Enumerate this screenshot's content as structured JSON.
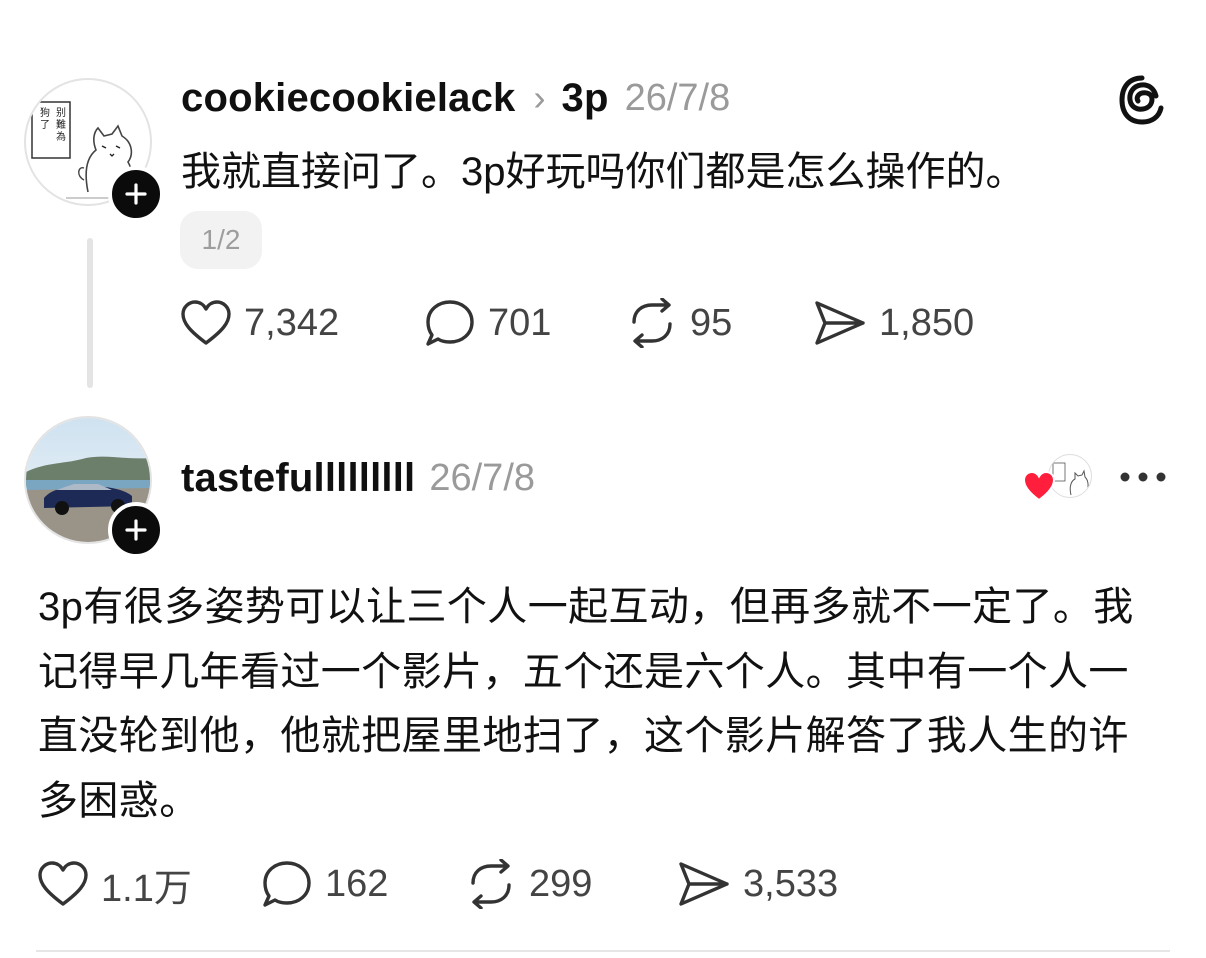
{
  "post1": {
    "username": "cookiecookielack",
    "chevron": "›",
    "topic": "3p",
    "date": "26/7/8",
    "text": "我就直接问了。3p好玩吗你们都是怎么操作的。",
    "page_indicator": "1/2",
    "likes": "7,342",
    "comments": "701",
    "reposts": "95",
    "shares": "1,850",
    "avatar_text": "别難為狗了"
  },
  "post2": {
    "username": "tastefulllllllll",
    "date": "26/7/8",
    "text": "3p有很多姿势可以让三个人一起互动，但再多就不一定了。我记得早几年看过一个影片，五个还是六个人。其中有一个人一直没轮到他，他就把屋里地扫了，这个影片解答了我人生的许多困惑。",
    "likes": "1.1万",
    "comments": "162",
    "reposts": "299",
    "shares": "3,533"
  },
  "icons": {
    "app_logo": "threads-logo-icon",
    "more": "more-options-icon",
    "follow": "plus-icon",
    "like": "heart-icon",
    "comment": "comment-bubble-icon",
    "repost": "repost-icon",
    "share": "send-icon",
    "liked_by_author": "red-heart-icon"
  },
  "colors": {
    "heart_red": "#ff1f3d",
    "text": "#101010",
    "muted": "#9a9a9a"
  }
}
